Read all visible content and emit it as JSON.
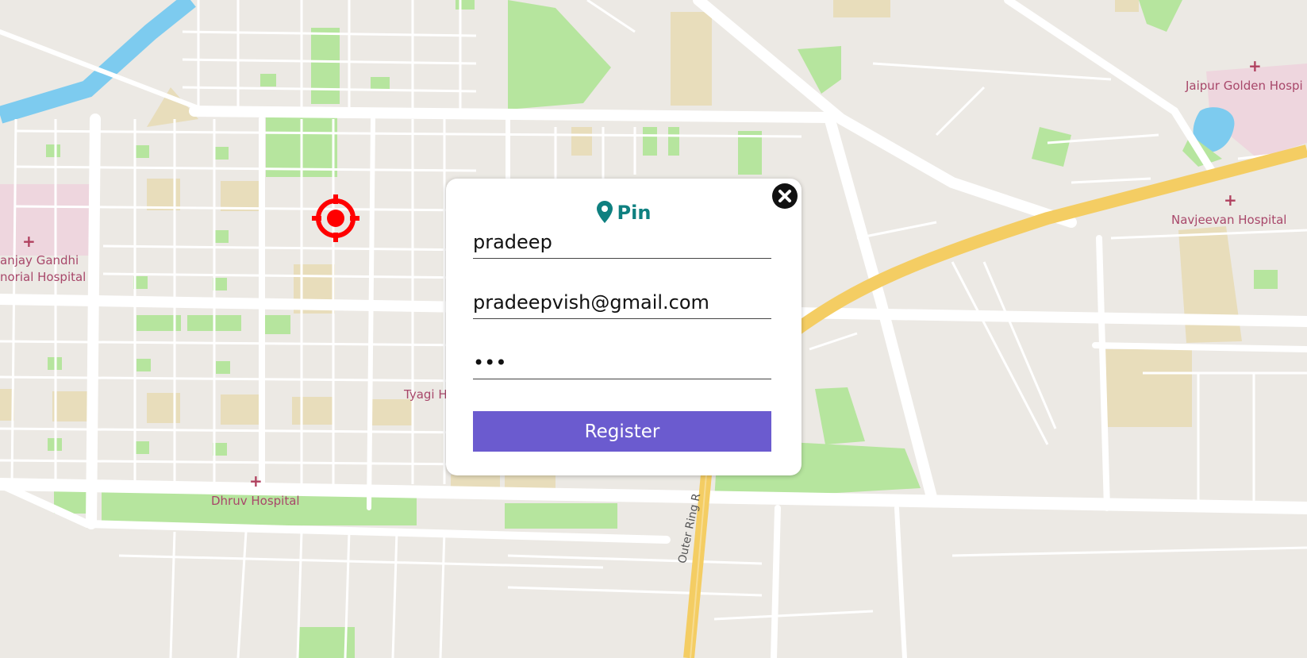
{
  "map": {
    "labels": {
      "jaipur_golden": "Jaipur Golden Hospi",
      "navjeevan": "Navjeevan Hospital",
      "sanjay_gandhi_1": "anjay Gandhi",
      "sanjay_gandhi_2": "norial Hospital",
      "tyagi": "Tyagi H",
      "dhruv": "Dhruv Hospital",
      "outer_ring": "Outer Ring R"
    },
    "colors": {
      "land": "#ece9e4",
      "road": "#ffffff",
      "park": "#b6e59e",
      "sand": "#e8ddbb",
      "hospital_area": "#eed6de",
      "water": "#7dcbef",
      "highway": "#f4cd63",
      "label": "#a8476a"
    }
  },
  "marker": {
    "icon": "target-crosshair-icon",
    "color": "#ff0000"
  },
  "popup": {
    "title": "Pin",
    "title_icon": "map-pin-icon",
    "title_color": "#0f8080",
    "username_value": "pradeep",
    "email_value": "pradeepvish@gmail.com",
    "password_value": "•••",
    "register_label": "Register",
    "button_color": "#6b5bcf",
    "close_icon": "close-icon"
  }
}
